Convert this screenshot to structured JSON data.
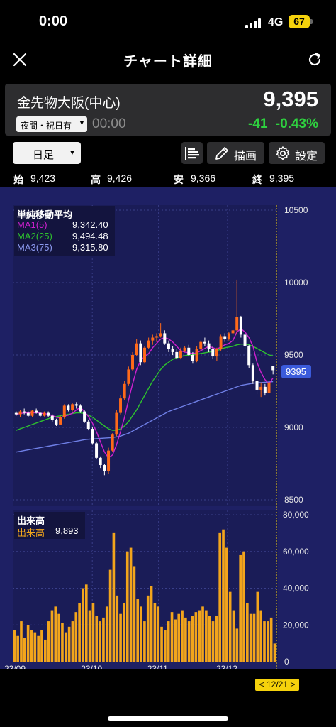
{
  "status_bar": {
    "time": "0:00",
    "network": "4G",
    "battery": "67"
  },
  "header": {
    "title": "チャート詳細",
    "close_icon": "close-icon",
    "refresh_icon": "refresh-icon"
  },
  "quote": {
    "name": "金先物大阪(中心)",
    "session": "夜間・祝日有",
    "time": "00:00",
    "price": "9,395",
    "change": "-41",
    "change_pct": "-0.43%"
  },
  "toolbar": {
    "period": "日足",
    "draw_label": "描画",
    "settings_label": "設定"
  },
  "ohlc": {
    "open_label": "始",
    "open": "9,423",
    "high_label": "高",
    "high": "9,426",
    "low_label": "安",
    "low": "9,366",
    "close_label": "終",
    "close": "9,395"
  },
  "ma_legend": {
    "title": "単純移動平均",
    "items": [
      {
        "label": "MA1(5)",
        "value": "9,342.40",
        "color": "#d020d0"
      },
      {
        "label": "MA2(25)",
        "value": "9,494.48",
        "color": "#2ec22e"
      },
      {
        "label": "MA3(75)",
        "value": "9,315.80",
        "color": "#6f7fe6"
      }
    ]
  },
  "volume_legend": {
    "title": "出来高",
    "label": "出来高",
    "value": "9,893"
  },
  "price_tag": "9395",
  "date_cursor": "< 12/21 >",
  "colors": {
    "background": "#1e2064",
    "up": "#ff6a1a",
    "down": "#ffffff",
    "volume": "#f2a51c",
    "ma1": "#d020d0",
    "ma2": "#2ec22e",
    "ma3": "#6f7fe6"
  },
  "chart_data": [
    {
      "type": "candlestick",
      "x_tick_labels": [
        "23/09",
        "23/10",
        "23/11",
        "23/12"
      ],
      "y_tick_labels": [
        "10500",
        "10000",
        "9500",
        "9000",
        "8500"
      ],
      "ylim": [
        8500,
        10500
      ],
      "grid": true,
      "ohlc": [
        [
          9100,
          9110,
          9080,
          9090
        ],
        [
          9090,
          9120,
          9070,
          9110
        ],
        [
          9110,
          9130,
          9090,
          9100
        ],
        [
          9100,
          9110,
          9070,
          9080
        ],
        [
          9080,
          9120,
          9070,
          9115
        ],
        [
          9115,
          9130,
          9095,
          9100
        ],
        [
          9100,
          9105,
          9070,
          9080
        ],
        [
          9080,
          9110,
          9075,
          9100
        ],
        [
          9100,
          9110,
          9070,
          9080
        ],
        [
          9080,
          9090,
          9040,
          9050
        ],
        [
          9050,
          9060,
          9010,
          9020
        ],
        [
          9020,
          9080,
          9015,
          9070
        ],
        [
          9070,
          9160,
          9060,
          9150
        ],
        [
          9150,
          9160,
          9110,
          9120
        ],
        [
          9120,
          9170,
          9110,
          9160
        ],
        [
          9160,
          9175,
          9130,
          9150
        ],
        [
          9150,
          9160,
          9100,
          9110
        ],
        [
          9110,
          9120,
          9030,
          9040
        ],
        [
          9040,
          9050,
          8980,
          8990
        ],
        [
          8990,
          9000,
          8880,
          8890
        ],
        [
          8890,
          8900,
          8780,
          8790
        ],
        [
          8790,
          8800,
          8720,
          8740
        ],
        [
          8740,
          8750,
          8670,
          8700
        ],
        [
          8700,
          8860,
          8680,
          8840
        ],
        [
          8840,
          8960,
          8830,
          8950
        ],
        [
          8950,
          9120,
          8940,
          9100
        ],
        [
          9100,
          9220,
          9090,
          9200
        ],
        [
          9200,
          9320,
          9190,
          9300
        ],
        [
          9300,
          9420,
          9290,
          9400
        ],
        [
          9400,
          9520,
          9390,
          9500
        ],
        [
          9500,
          9610,
          9490,
          9580
        ],
        [
          9580,
          9600,
          9430,
          9450
        ],
        [
          9450,
          9560,
          9440,
          9550
        ],
        [
          9550,
          9620,
          9540,
          9600
        ],
        [
          9600,
          9640,
          9570,
          9620
        ],
        [
          9620,
          9650,
          9590,
          9630
        ],
        [
          9630,
          9720,
          9620,
          9650
        ],
        [
          9650,
          9670,
          9570,
          9580
        ],
        [
          9580,
          9600,
          9520,
          9540
        ],
        [
          9540,
          9560,
          9500,
          9520
        ],
        [
          9520,
          9540,
          9470,
          9480
        ],
        [
          9480,
          9550,
          9470,
          9530
        ],
        [
          9530,
          9560,
          9520,
          9550
        ],
        [
          9550,
          9570,
          9490,
          9500
        ],
        [
          9500,
          9520,
          9440,
          9460
        ],
        [
          9460,
          9560,
          9450,
          9540
        ],
        [
          9540,
          9600,
          9530,
          9590
        ],
        [
          9590,
          9620,
          9560,
          9580
        ],
        [
          9580,
          9600,
          9520,
          9540
        ],
        [
          9540,
          9560,
          9470,
          9490
        ],
        [
          9490,
          9550,
          9460,
          9540
        ],
        [
          9540,
          9640,
          9530,
          9630
        ],
        [
          9630,
          9650,
          9590,
          9610
        ],
        [
          9610,
          9660,
          9600,
          9650
        ],
        [
          9650,
          9680,
          9630,
          9670
        ],
        [
          9670,
          10020,
          9640,
          9760
        ],
        [
          9760,
          9770,
          9620,
          9640
        ],
        [
          9640,
          9650,
          9540,
          9560
        ],
        [
          9560,
          9570,
          9410,
          9430
        ],
        [
          9430,
          9440,
          9300,
          9320
        ],
        [
          9320,
          9340,
          9230,
          9260
        ],
        [
          9260,
          9310,
          9210,
          9280
        ],
        [
          9280,
          9300,
          9220,
          9240
        ],
        [
          9240,
          9320,
          9230,
          9310
        ],
        [
          9423,
          9426,
          9366,
          9395
        ]
      ],
      "ma1": [
        9090,
        9095,
        9100,
        9100,
        9099,
        9103,
        9097,
        9095,
        9090,
        9082,
        9070,
        9066,
        9078,
        9085,
        9098,
        9120,
        9138,
        9110,
        9075,
        9030,
        8970,
        8900,
        8830,
        8790,
        8810,
        8880,
        8970,
        9070,
        9190,
        9300,
        9400,
        9460,
        9490,
        9510,
        9550,
        9580,
        9610,
        9620,
        9610,
        9590,
        9560,
        9530,
        9520,
        9515,
        9510,
        9515,
        9530,
        9545,
        9560,
        9550,
        9540,
        9555,
        9570,
        9580,
        9600,
        9660,
        9680,
        9660,
        9620,
        9560,
        9450,
        9380,
        9330,
        9300,
        9342
      ],
      "ma2": [
        8980,
        8990,
        9000,
        9010,
        9020,
        9030,
        9040,
        9050,
        9060,
        9070,
        9075,
        9080,
        9085,
        9090,
        9095,
        9100,
        9100,
        9095,
        9085,
        9070,
        9050,
        9030,
        9010,
        8990,
        8980,
        8980,
        8990,
        9010,
        9040,
        9080,
        9120,
        9170,
        9220,
        9270,
        9320,
        9360,
        9400,
        9430,
        9450,
        9470,
        9480,
        9490,
        9495,
        9500,
        9500,
        9505,
        9510,
        9515,
        9520,
        9525,
        9530,
        9540,
        9550,
        9555,
        9560,
        9570,
        9575,
        9575,
        9570,
        9560,
        9545,
        9530,
        9515,
        9500,
        9494
      ],
      "ma3": [
        8830,
        8835,
        8840,
        8845,
        8850,
        8855,
        8860,
        8865,
        8870,
        8875,
        8880,
        8885,
        8890,
        8895,
        8900,
        8905,
        8910,
        8915,
        8918,
        8920,
        8922,
        8924,
        8926,
        8928,
        8930,
        8935,
        8940,
        8950,
        8960,
        8975,
        8990,
        9005,
        9020,
        9035,
        9050,
        9065,
        9080,
        9095,
        9110,
        9120,
        9130,
        9140,
        9150,
        9160,
        9170,
        9180,
        9190,
        9200,
        9210,
        9220,
        9230,
        9240,
        9250,
        9260,
        9270,
        9280,
        9290,
        9295,
        9300,
        9305,
        9308,
        9310,
        9312,
        9314,
        9316
      ]
    },
    {
      "type": "bar",
      "series_name": "出来高",
      "y_tick_labels": [
        "80,000",
        "60,000",
        "40,000",
        "20,000",
        "0"
      ],
      "ylim": [
        0,
        80000
      ],
      "values": [
        17000,
        14000,
        22000,
        13000,
        20000,
        17000,
        16000,
        14000,
        17000,
        12000,
        22000,
        28000,
        30000,
        26000,
        21000,
        16000,
        19000,
        22000,
        27000,
        32000,
        40000,
        42000,
        28000,
        32000,
        25000,
        22000,
        24000,
        30000,
        50000,
        70000,
        36000,
        26000,
        32000,
        60000,
        62000,
        52000,
        34000,
        30000,
        22000,
        36000,
        41000,
        32000,
        30000,
        19000,
        17000,
        22000,
        27000,
        23000,
        26000,
        28000,
        24000,
        22000,
        25000,
        27000,
        28000,
        30000,
        28000,
        25000,
        22000,
        25000,
        70000,
        72000,
        62000,
        38000,
        28000,
        18000,
        58000,
        60000,
        32000,
        26000,
        26000,
        38000,
        28000,
        22000,
        22000,
        24000,
        9893
      ]
    }
  ]
}
